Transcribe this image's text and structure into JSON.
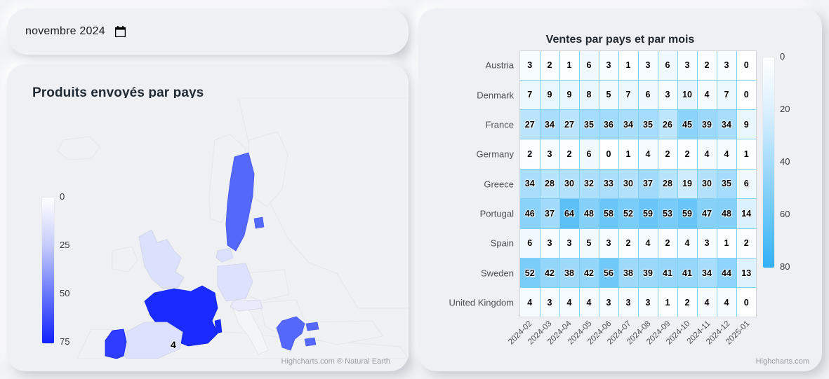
{
  "date_filter": {
    "value": "novembre 2024",
    "icon": "calendar-icon"
  },
  "map_card": {
    "title": "Produits envoyés par pays",
    "credit": "Highcharts.com ® Natural Earth",
    "legend": {
      "ticks": [
        "0",
        "25",
        "50",
        "75"
      ],
      "min": 0,
      "max": 75,
      "color_low": "#ffffff",
      "color_high": "#1122ff"
    },
    "point_labels": [
      {
        "country": "United Kingdom",
        "value": "4"
      }
    ],
    "country_values": [
      {
        "country": "France",
        "value": 45,
        "color": "#1a2bff"
      },
      {
        "country": "Portugal",
        "value": 47,
        "color": "#2e3cff"
      },
      {
        "country": "Sweden",
        "value": 34,
        "color": "#5468fb"
      },
      {
        "country": "Greece",
        "value": 30,
        "color": "#5468fb"
      },
      {
        "country": "Spain",
        "value": 3,
        "color": "#dde1fd"
      },
      {
        "country": "United Kingdom",
        "value": 4,
        "color": "#dbe0fd"
      },
      {
        "country": "Germany",
        "value": 4,
        "color": "#dbe0fd"
      },
      {
        "country": "Austria",
        "value": 2,
        "color": "#e6e9fc"
      },
      {
        "country": "Denmark",
        "value": 4,
        "color": "#dbe0fd"
      }
    ]
  },
  "heatmap_card": {
    "credit": "Highcharts.com"
  },
  "chart_data": {
    "type": "heatmap",
    "title": "Ventes par pays et par mois",
    "xlabel": "",
    "ylabel": "",
    "categories_x": [
      "2024-02",
      "2024-03",
      "2024-04",
      "2024-05",
      "2024-06",
      "2024-07",
      "2024-08",
      "2024-09",
      "2024-10",
      "2024-11",
      "2024-12",
      "2025-01"
    ],
    "categories_y": [
      "Austria",
      "Denmark",
      "France",
      "Germany",
      "Greece",
      "Portugal",
      "Spain",
      "Sweden",
      "United Kingdom"
    ],
    "colorbar": {
      "ticks": [
        0,
        20,
        40,
        60,
        80
      ],
      "min": 0,
      "max": 80,
      "color_low": "#ffffff",
      "color_high": "#33b0f5"
    },
    "grid": true,
    "legend_position": "right",
    "series": [
      {
        "name": "Austria",
        "values": [
          3,
          2,
          1,
          6,
          3,
          1,
          3,
          6,
          3,
          2,
          3,
          0
        ]
      },
      {
        "name": "Denmark",
        "values": [
          7,
          9,
          9,
          8,
          5,
          7,
          6,
          3,
          10,
          4,
          7,
          0
        ]
      },
      {
        "name": "France",
        "values": [
          27,
          34,
          27,
          35,
          36,
          34,
          35,
          26,
          45,
          39,
          34,
          9
        ]
      },
      {
        "name": "Germany",
        "values": [
          2,
          3,
          2,
          6,
          0,
          1,
          4,
          2,
          2,
          4,
          4,
          1
        ]
      },
      {
        "name": "Greece",
        "values": [
          34,
          28,
          30,
          32,
          33,
          30,
          37,
          28,
          19,
          30,
          35,
          6
        ]
      },
      {
        "name": "Portugal",
        "values": [
          46,
          37,
          64,
          48,
          58,
          52,
          59,
          53,
          59,
          47,
          48,
          14
        ]
      },
      {
        "name": "Spain",
        "values": [
          6,
          3,
          3,
          5,
          3,
          2,
          4,
          2,
          4,
          3,
          1,
          2
        ]
      },
      {
        "name": "Sweden",
        "values": [
          52,
          42,
          38,
          42,
          56,
          38,
          39,
          41,
          41,
          34,
          44,
          13
        ]
      },
      {
        "name": "United Kingdom",
        "values": [
          4,
          3,
          4,
          4,
          3,
          3,
          3,
          1,
          2,
          4,
          4,
          0
        ]
      }
    ]
  }
}
